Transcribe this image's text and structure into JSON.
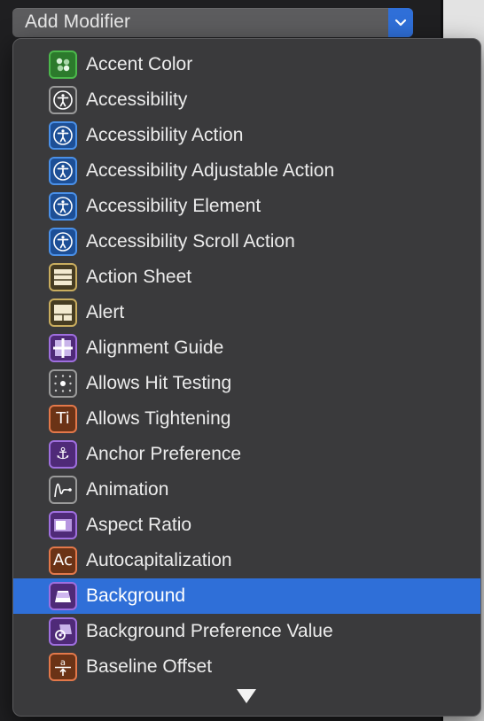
{
  "popup": {
    "label": "Add Modifier"
  },
  "menu": {
    "selected_index": 15,
    "items": [
      {
        "label": "Accent Color",
        "icon": "accent-color-icon",
        "icon_color": "green"
      },
      {
        "label": "Accessibility",
        "icon": "accessibility-icon",
        "icon_color": "gray"
      },
      {
        "label": "Accessibility Action",
        "icon": "accessibility-icon",
        "icon_color": "blue"
      },
      {
        "label": "Accessibility Adjustable Action",
        "icon": "accessibility-icon",
        "icon_color": "blue"
      },
      {
        "label": "Accessibility Element",
        "icon": "accessibility-icon",
        "icon_color": "blue"
      },
      {
        "label": "Accessibility Scroll Action",
        "icon": "accessibility-icon",
        "icon_color": "blue"
      },
      {
        "label": "Action Sheet",
        "icon": "action-sheet-icon",
        "icon_color": "tan"
      },
      {
        "label": "Alert",
        "icon": "alert-icon",
        "icon_color": "tan"
      },
      {
        "label": "Alignment Guide",
        "icon": "alignment-guide-icon",
        "icon_color": "purple"
      },
      {
        "label": "Allows Hit Testing",
        "icon": "hit-testing-icon",
        "icon_color": "gray"
      },
      {
        "label": "Allows Tightening",
        "icon": "tightening-icon",
        "icon_color": "orange",
        "glyph": "Ti"
      },
      {
        "label": "Anchor Preference",
        "icon": "anchor-icon",
        "icon_color": "purple",
        "glyph": "⚓"
      },
      {
        "label": "Animation",
        "icon": "animation-icon",
        "icon_color": "gray"
      },
      {
        "label": "Aspect Ratio",
        "icon": "aspect-ratio-icon",
        "icon_color": "purple"
      },
      {
        "label": "Autocapitalization",
        "icon": "autocapitalization-icon",
        "icon_color": "orange",
        "glyph": "Ac"
      },
      {
        "label": "Background",
        "icon": "background-icon",
        "icon_color": "purple"
      },
      {
        "label": "Background Preference Value",
        "icon": "background-preference-icon",
        "icon_color": "purple"
      },
      {
        "label": "Baseline Offset",
        "icon": "baseline-offset-icon",
        "icon_color": "orange"
      }
    ]
  },
  "colors": {
    "selection": "#2f6fd8",
    "menu_background": "#3a3a3c"
  }
}
